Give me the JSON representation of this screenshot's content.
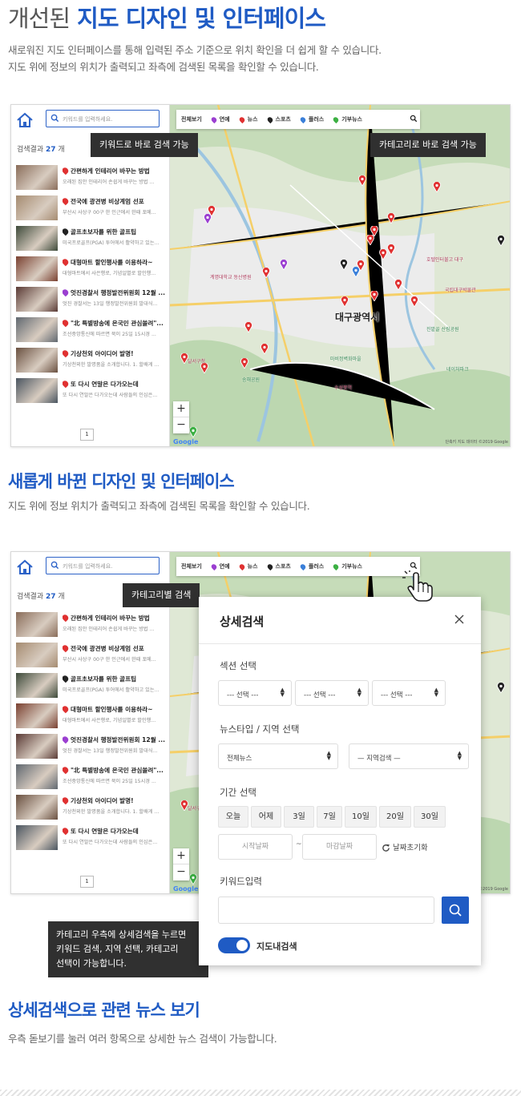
{
  "section1": {
    "title_light": "개선된",
    "title_bold": "지도 디자인 및 인터페이스",
    "desc1": "새로워진 지도 인터페이스를 통해 입력된 주소 기준으로 위치 확인을 더 쉽게 할 수 있습니다.",
    "desc2": "지도 위에 정보의 위치가 출력되고 좌측에 검색된 목록을 확인할 수 있습니다."
  },
  "section2": {
    "title": "새롭게 바뀐 디자인 및 인터페이스",
    "desc": "지도 위에 정보 위치가 출력되고 좌측에 검색된 목록을 확인할 수 있습니다."
  },
  "section3": {
    "title": "상세검색으로 관련 뉴스 보기",
    "desc": "우측 돋보기를 눌러 여러 항목으로 상세한 뉴스 검색이 가능합니다."
  },
  "app": {
    "search_placeholder": "키워드를 입력하세요.",
    "count_prefix": "검색결과",
    "count": "27",
    "count_suffix": "개",
    "page": "1",
    "categories": [
      {
        "label": "전체보기",
        "color": ""
      },
      {
        "label": "연예",
        "color": "#9b3fd1"
      },
      {
        "label": "뉴스",
        "color": "#e03131"
      },
      {
        "label": "스포츠",
        "color": "#222222"
      },
      {
        "label": "플러스",
        "color": "#3a7fd9"
      },
      {
        "label": "기부뉴스",
        "color": "#3cb043"
      }
    ],
    "items": [
      {
        "title": "간편하게 인테리어 바꾸는 방법",
        "sub": "오래된 집안 인테리어 손쉽게 바꾸는 방법 ...",
        "pin": "#e03131",
        "thumb": "#8a6d5a"
      },
      {
        "title": "전국에 광견병 비상계엄 선포",
        "sub": "부산시 사상구 00구 한 인근에서 한때 포메...",
        "pin": "#e03131",
        "thumb": "#a58b70"
      },
      {
        "title": "골프초보자를 위한 골프팁",
        "sub": "미국프로골프(PGA) 투어에서 활약하고 있는...",
        "pin": "#222222",
        "thumb": "#3d4a3a"
      },
      {
        "title": "대형마트 할인행사를 이용하라~",
        "sub": "대형마트에서 사은행로, 기념일별로 할인행...",
        "pin": "#e03131",
        "thumb": "#7a4030"
      },
      {
        "title": "엇진경찰서 행정발전위원회 12월 ...",
        "sub": "엇진 경찰서는 13일 행정발전위원회 발대식...",
        "pin": "#9b3fd1",
        "thumb": "#5a3a35"
      },
      {
        "title": "\"北 특별방송에 온국민 관심쏠려\"...",
        "sub": "조선중앙통신에 따르면 북이 25일 15시경 ...",
        "pin": "#e03131",
        "thumb": "#606870"
      },
      {
        "title": "기상천외 아이디어 발명!",
        "sub": "기상천외한 발명품을 소개합니다. 1. 할배게 ...",
        "pin": "#e03131",
        "thumb": "#6a5040"
      },
      {
        "title": "또 다시 연말은 다가오는데",
        "sub": "또 다시 연말은 다가오는데 사람들의 인심은...",
        "pin": "#e03131",
        "thumb": "#4a5560"
      }
    ],
    "map_city": "대구광역시",
    "map_pois": [
      "계명대학교 동산병원",
      "호텔인터불고 대구",
      "국립대구박물관",
      "진밭골 산림공원",
      "마비정벽화마을",
      "네이처파크",
      "달서구청",
      "송해공원",
      "수성못역"
    ],
    "map_credit": "단축키 지도 데이터 ©2019 Google"
  },
  "tips": {
    "keyword": "키워드로 바로 검색 가능",
    "category": "카테고리로 바로 검색 가능",
    "category_search": "카테고리별 검색",
    "detail_line1": "카테고리 우측에 상세검색을 누르면",
    "detail_line2": "키워드 검색, 지역 선택, 카테고리",
    "detail_line3": "선택이 가능합니다."
  },
  "modal": {
    "title": "상세검색",
    "section_label": "섹션 선택",
    "section_selects": [
      "--- 선택 ---",
      "--- 선택 ---",
      "--- 선택 ---"
    ],
    "newstype_label": "뉴스타입 / 지역 선택",
    "newstype_value": "전체뉴스",
    "region_value": "— 지역검색 —",
    "period_label": "기간 선택",
    "periods": [
      "오늘",
      "어제",
      "3일",
      "7일",
      "10일",
      "20일",
      "30일"
    ],
    "start_placeholder": "시작날짜",
    "end_placeholder": "마감날짜",
    "tilde": "~",
    "reset_label": "날짜초기화",
    "keyword_label": "키워드입력",
    "toggle_label": "지도내검색"
  }
}
